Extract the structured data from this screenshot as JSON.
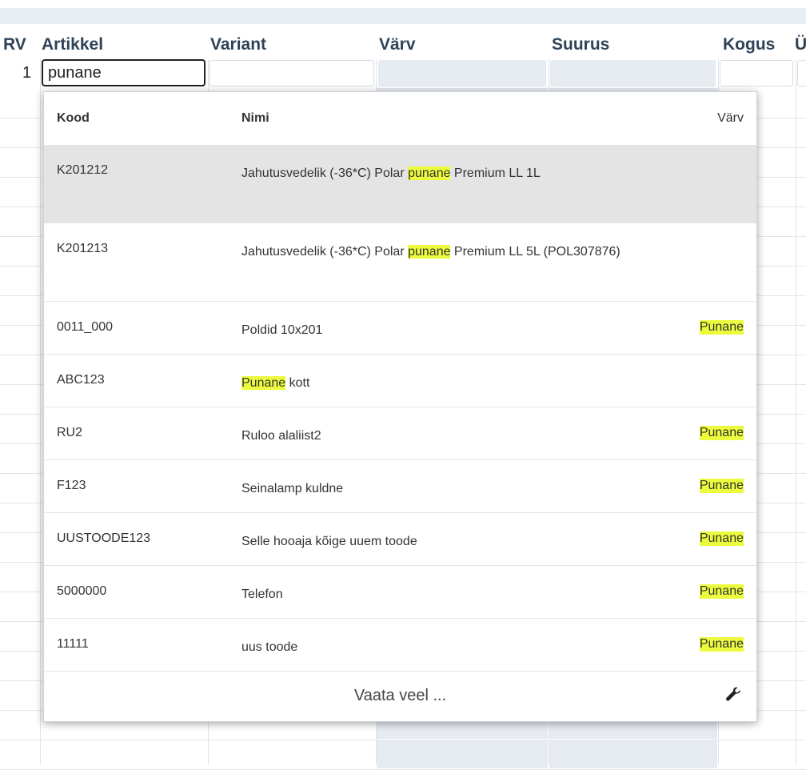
{
  "table": {
    "columns": [
      "RV",
      "Artikkel",
      "Variant",
      "Värv",
      "Suurus",
      "Kogus",
      "Ü"
    ],
    "row_number": "1",
    "artikkel_value": "punane"
  },
  "popup": {
    "headers": {
      "code": "Kood",
      "name": "Nimi",
      "color": "Värv"
    },
    "rows": [
      {
        "code": "K201212",
        "name_pre": "Jahutusvedelik (-36*C) Polar ",
        "name_hl": "punane",
        "name_post": " Premium LL 1L",
        "color": ""
      },
      {
        "code": "K201213",
        "name_pre": "Jahutusvedelik (-36*C) Polar ",
        "name_hl": "punane",
        "name_post": " Premium LL 5L (POL307876)",
        "color": ""
      },
      {
        "code": "0011_000",
        "name_pre": "Poldid 10x201",
        "name_hl": "",
        "name_post": "",
        "color": "Punane"
      },
      {
        "code": "ABC123",
        "name_pre": "",
        "name_hl": "Punane",
        "name_post": " kott",
        "color": ""
      },
      {
        "code": "RU2",
        "name_pre": "Ruloo alaliist2",
        "name_hl": "",
        "name_post": "",
        "color": "Punane"
      },
      {
        "code": "F123",
        "name_pre": "Seinalamp kuldne",
        "name_hl": "",
        "name_post": "",
        "color": "Punane"
      },
      {
        "code": "UUSTOODE123",
        "name_pre": "Selle hooaja kõige uuem toode",
        "name_hl": "",
        "name_post": "",
        "color": "Punane"
      },
      {
        "code": "5000000",
        "name_pre": "Telefon",
        "name_hl": "",
        "name_post": "",
        "color": "Punane"
      },
      {
        "code": "11111",
        "name_pre": "uus toode",
        "name_hl": "",
        "name_post": "",
        "color": "Punane"
      }
    ],
    "more_label": "Vaata veel ...",
    "settings_icon": "wrench-icon",
    "highlight_color": "#ecfc3c",
    "selected_row_color": "#e4e4e4"
  }
}
